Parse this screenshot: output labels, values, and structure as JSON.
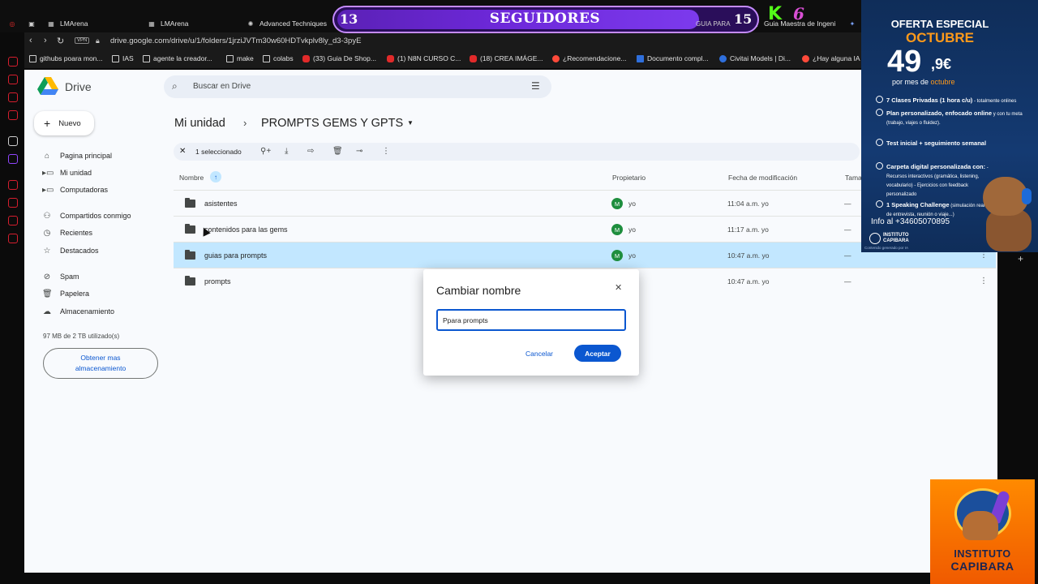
{
  "browser": {
    "tabs": [
      {
        "label": "LMArena"
      },
      {
        "label": "LMArena"
      },
      {
        "label": "Advanced Techniques"
      },
      {
        "label": "Guia Maestra de Ingeni"
      }
    ],
    "url": "drive.google.com/drive/u/1/folders/1jrziJVTm30w60HDTvkplv8ly_d3-3pyE",
    "vpn_label": "VPN",
    "bookmarks": [
      "githubs poara mon...",
      "IAS",
      "agente la creador...",
      "make",
      "colabs",
      "(33) Guia De Shop...",
      "(1) N8N CURSO C...",
      "(18) CREA IMÁGE...",
      "¿Recomendacione...",
      "Documento compl...",
      "Civitai Models | Di...",
      "¿Hay alguna IA"
    ]
  },
  "drive": {
    "app_name": "Drive",
    "search_placeholder": "Buscar en Drive",
    "new_label": "Nuevo",
    "sidebar": [
      {
        "label": "Pagina principal",
        "icon": "home-icon"
      },
      {
        "label": "Mi unidad",
        "icon": "my-drive-icon"
      },
      {
        "label": "Computadoras",
        "icon": "computer-icon"
      },
      {
        "label": "Compartidos conmigo",
        "icon": "people-icon"
      },
      {
        "label": "Recientes",
        "icon": "clock-icon"
      },
      {
        "label": "Destacados",
        "icon": "star-icon"
      },
      {
        "label": "Spam",
        "icon": "spam-icon"
      },
      {
        "label": "Papelera",
        "icon": "trash-icon"
      },
      {
        "label": "Almacenamiento",
        "icon": "cloud-icon"
      }
    ],
    "storage_text": "97 MB de 2 TB utilizado(s)",
    "storage_button": "Obtener mas almacenamiento",
    "breadcrumb": {
      "root": "Mi unidad",
      "current": "PROMPTS GEMS Y GPTS"
    },
    "selection": {
      "text": "1 seleccionado"
    },
    "columns": {
      "name": "Nombre",
      "owner": "Propietario",
      "modified": "Fecha de modificación",
      "size": "Tama"
    },
    "rows": [
      {
        "name": "asistentes",
        "owner_initial": "M",
        "owner": "yo",
        "modified": "11:04 a.m. yo",
        "size": "—"
      },
      {
        "name": "contenidos para las gems",
        "owner_initial": "M",
        "owner": "yo",
        "modified": "11:17 a.m. yo",
        "size": "—"
      },
      {
        "name": "guias para prompts",
        "owner_initial": "M",
        "owner": "yo",
        "modified": "10:47 a.m. yo",
        "size": "—",
        "selected": true
      },
      {
        "name": "prompts",
        "owner_initial": "",
        "owner": "",
        "modified": "10:47 a.m. yo",
        "size": "—"
      }
    ],
    "dialog": {
      "title": "Cambiar nombre",
      "input_value": "Ppara prompts",
      "cancel": "Cancelar",
      "ok": "Aceptar"
    }
  },
  "overlay": {
    "followers_left": "13",
    "followers_title": "SEGUIDORES",
    "followers_right": "15",
    "followers_peek": "GUIA PARA",
    "kick_letter": "K",
    "kick_count": "6"
  },
  "ad": {
    "line1": "OFERTA ESPECIAL",
    "line2": "OCTUBRE",
    "price": "49",
    "price_decimal": ",9€",
    "per_month_a": "por mes de ",
    "per_month_b": "octubre",
    "items": [
      {
        "bold": "7 Clases Privadas (1 hora c/u)",
        "small": " - totalmente onlines"
      },
      {
        "bold": "Plan personalizado, enfocado online",
        "small": " y con tu meta (trabajo, viajes o fluidez)."
      },
      {
        "bold": "Test inicial + seguimiento semanal",
        "small": ""
      },
      {
        "bold": "Carpeta digital personalizada con:",
        "small": " - Recursos interactivos (gramática, listening, vocabulario) - Ejercicios con feedback personalizado"
      },
      {
        "bold": "1 Speaking Challenge",
        "small": " (simulación real de entrevista, reunión o viaje...)"
      }
    ],
    "info": "Info al +34605070895",
    "logo_line1": "INSTITUTO",
    "logo_line2": "CAPIBARA",
    "footer": "Contenido generado por IA"
  },
  "brand_logo": {
    "line1": "INSTITUTO",
    "line2": "CAPIBARA"
  },
  "colors": {
    "accent": "#0b57d0",
    "selected_row": "#c2e7ff",
    "overlay_purple": "#6d28d9",
    "ad_orange": "#ff9a1a"
  }
}
